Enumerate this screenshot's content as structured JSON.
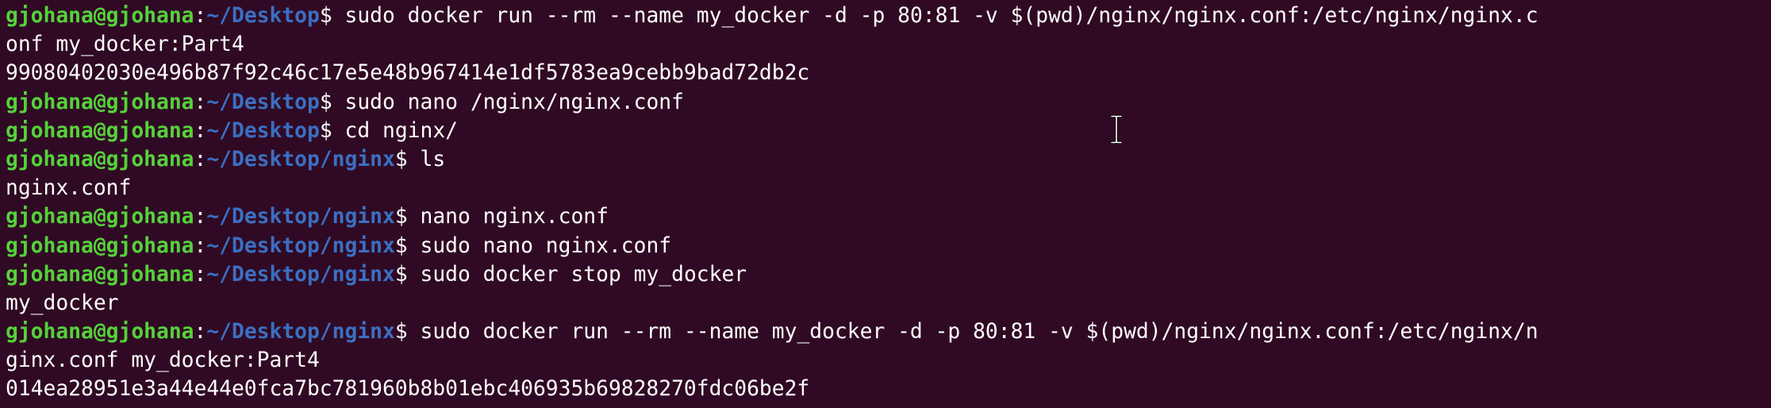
{
  "terminal": {
    "user_host": "gjohana@gjohana",
    "lines": [
      {
        "type": "prompt",
        "path": "~/Desktop",
        "command": "sudo docker run --rm --name my_docker -d -p 80:81 -v $(pwd)/nginx/nginx.conf:/etc/nginx/nginx.c"
      },
      {
        "type": "output",
        "text": "onf my_docker:Part4"
      },
      {
        "type": "output",
        "text": "99080402030e496b87f92c46c17e5e48b967414e1df5783ea9cebb9bad72db2c"
      },
      {
        "type": "prompt",
        "path": "~/Desktop",
        "command": "sudo nano /nginx/nginx.conf"
      },
      {
        "type": "prompt",
        "path": "~/Desktop",
        "command": "cd nginx/"
      },
      {
        "type": "prompt",
        "path": "~/Desktop/nginx",
        "command": "ls"
      },
      {
        "type": "output",
        "text": "nginx.conf"
      },
      {
        "type": "prompt",
        "path": "~/Desktop/nginx",
        "command": "nano nginx.conf"
      },
      {
        "type": "prompt",
        "path": "~/Desktop/nginx",
        "command": "sudo nano nginx.conf"
      },
      {
        "type": "prompt",
        "path": "~/Desktop/nginx",
        "command": "sudo docker stop my_docker"
      },
      {
        "type": "output",
        "text": "my_docker"
      },
      {
        "type": "prompt",
        "path": "~/Desktop/nginx",
        "command": "sudo docker run --rm --name my_docker -d -p 80:81 -v $(pwd)/nginx/nginx.conf:/etc/nginx/n"
      },
      {
        "type": "output",
        "text": "ginx.conf my_docker:Part4"
      },
      {
        "type": "output",
        "text": "014ea28951e3a44e44e0fca7bc781960b8b01ebc406935b69828270fdc06be2f"
      }
    ]
  },
  "colors": {
    "background": "#300a24",
    "user_host": "#55d23b",
    "path": "#3b6fc2",
    "text": "#ffffff"
  },
  "cursor_icon": "text-ibeam-cursor-icon"
}
